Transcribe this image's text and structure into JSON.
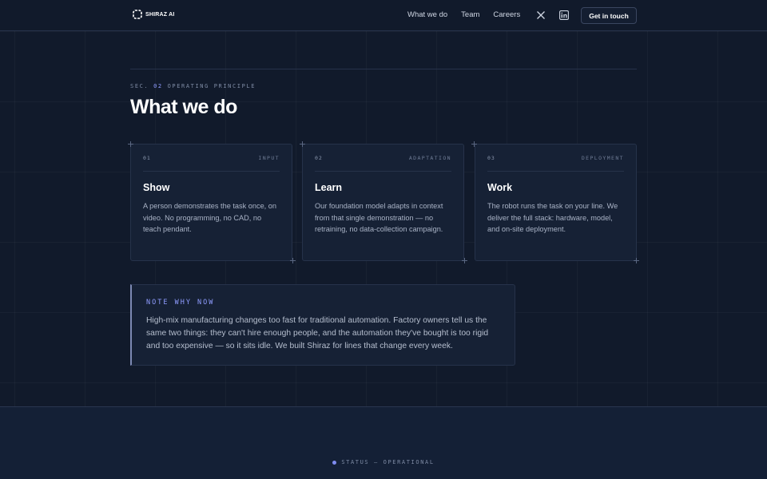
{
  "brand": {
    "name": "SHIRAZ AI"
  },
  "nav": {
    "items": [
      "What we do",
      "Team",
      "Careers"
    ],
    "social": [
      "x-icon",
      "linkedin-icon"
    ],
    "cta_label": "Get in touch"
  },
  "section": {
    "prefix": "SEC.",
    "number": "02",
    "label": "OPERATING PRINCIPLE",
    "title": "What we do"
  },
  "cards": [
    {
      "num": "01",
      "tag": "INPUT",
      "title": "Show",
      "body": "A person demonstrates the task once, on video. No programming, no CAD, no teach pendant."
    },
    {
      "num": "02",
      "tag": "ADAPTATION",
      "title": "Learn",
      "body": "Our foundation model adapts in context from that single demonstration — no retraining, no data-collection campaign."
    },
    {
      "num": "03",
      "tag": "DEPLOYMENT",
      "title": "Work",
      "body": "The robot runs the task on your line. We deliver the full stack: hardware, model, and on-site deployment."
    }
  ],
  "note": {
    "label": "NOTE WHY NOW",
    "body": "High-mix manufacturing changes too fast for traditional automation. Factory owners tell us the same two things: they can't hire enough people, and the automation they've bought is too rigid and too expensive — so it sits idle. We built Shiraz for lines that change every week."
  },
  "footer": {
    "status": "STATUS — OPERATIONAL"
  },
  "colors": {
    "background": "#111a2b",
    "card": "#162135",
    "accent": "#8f9cff",
    "border": "#26324a"
  }
}
